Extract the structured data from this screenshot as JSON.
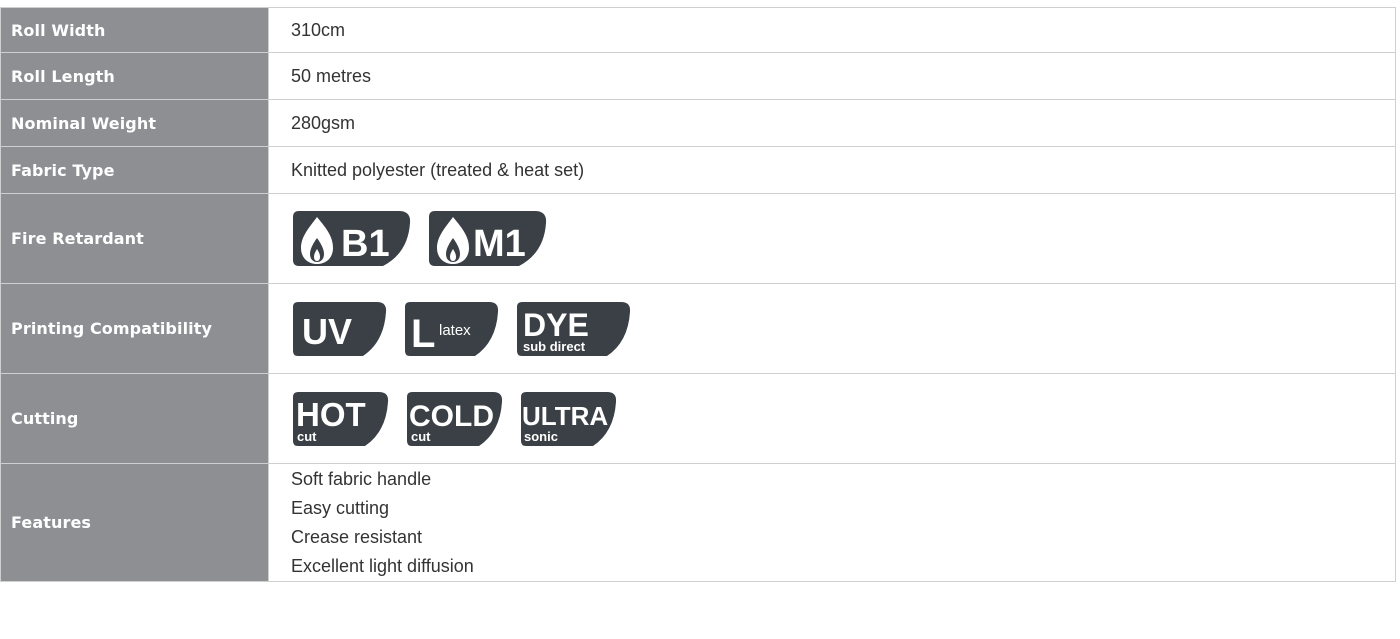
{
  "specs": {
    "roll_width": {
      "label": "Roll Width",
      "value": "310cm"
    },
    "roll_length": {
      "label": "Roll Length",
      "value": "50 metres"
    },
    "nominal_weight": {
      "label": "Nominal Weight",
      "value": "280gsm"
    },
    "fabric_type": {
      "label": "Fabric Type",
      "value": "Knitted polyester (treated & heat set)"
    },
    "fire_retardant": {
      "label": "Fire Retardant",
      "badges": [
        {
          "icon": "flame-icon",
          "text": "B1"
        },
        {
          "icon": "flame-icon",
          "text": "M1"
        }
      ]
    },
    "printing_compatibility": {
      "label": "Printing Compatibility",
      "badges": [
        {
          "main": "UV",
          "sub": ""
        },
        {
          "main": "L",
          "sub": "latex"
        },
        {
          "main": "DYE",
          "sub": "sub direct"
        }
      ]
    },
    "cutting": {
      "label": "Cutting",
      "badges": [
        {
          "main": "HOT",
          "sub": "cut"
        },
        {
          "main": "COLD",
          "sub": "cut"
        },
        {
          "main": "ULTRA",
          "sub": "sonic"
        }
      ]
    },
    "features": {
      "label": "Features",
      "items": [
        "Soft fabric handle",
        "Easy cutting",
        "Crease resistant",
        "Excellent light diffusion"
      ]
    }
  },
  "colors": {
    "label_bg": "#8e8f93",
    "badge_fill": "#3a4045",
    "border": "#cfcfcf"
  }
}
